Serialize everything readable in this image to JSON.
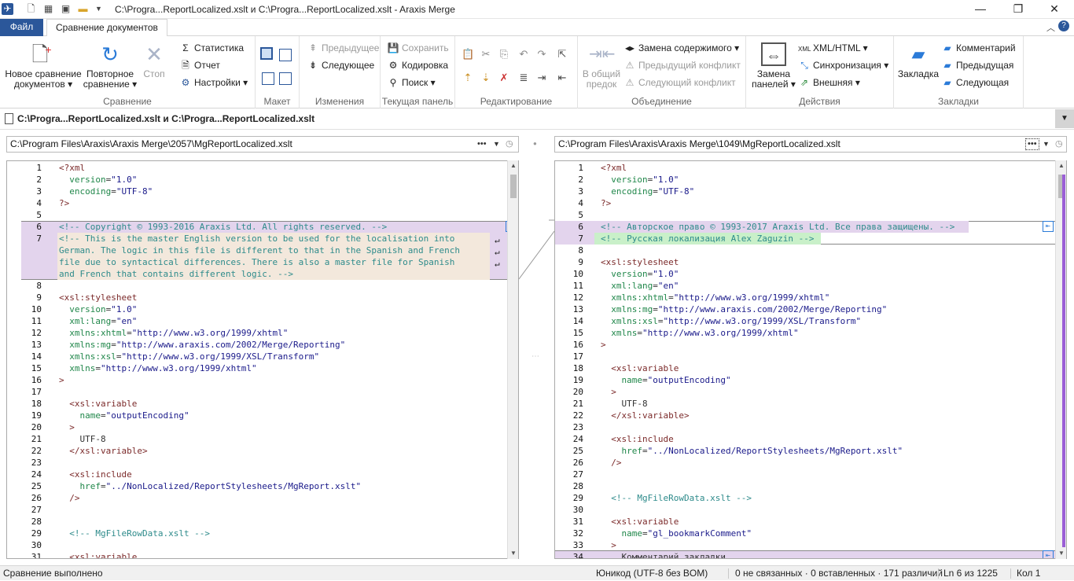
{
  "window": {
    "title": "C:\\Progra...ReportLocalized.xslt и C:\\Progra...ReportLocalized.xslt - Araxis Merge",
    "minimize": "—",
    "restore": "❐",
    "close": "✕"
  },
  "tabs": {
    "file": "Файл",
    "compare": "Сравнение документов"
  },
  "ribbon": {
    "compare_group": {
      "label": "Сравнение",
      "new_compare": "Новое сравнение документов",
      "new_compare_l1": "Новое сравнение",
      "new_compare_l2": "документов",
      "recompare_l1": "Повторное",
      "recompare_l2": "сравнение",
      "stop": "Стоп",
      "statistics": "Статистика",
      "report": "Отчет",
      "settings": "Настройки"
    },
    "layout_group": {
      "label": "Макет"
    },
    "changes_group": {
      "label": "Изменения",
      "previous": "Предыдущее",
      "next": "Следующее"
    },
    "panel_group": {
      "label": "Текущая панель",
      "save": "Сохранить",
      "encoding": "Кодировка",
      "search": "Поиск"
    },
    "edit_group": {
      "label": "Редактирование"
    },
    "merge_group": {
      "label": "Объединение",
      "common_ancestor_l1": "В общий",
      "common_ancestor_l2": "предок",
      "replace_content": "Замена содержимого",
      "prev_conflict": "Предыдущий конфликт",
      "next_conflict": "Следующий конфликт"
    },
    "actions_group": {
      "label": "Действия",
      "replace_panels_l1": "Замена",
      "replace_panels_l2": "панелей",
      "xml_html": "XML/HTML",
      "sync": "Синхронизация",
      "external": "Внешняя"
    },
    "bookmarks_group": {
      "label": "Закладки",
      "bookmark": "Закладка",
      "comment": "Комментарий",
      "previous": "Предыдущая",
      "next": "Следующая"
    }
  },
  "doc_tab": {
    "title": "C:\\Progra...ReportLocalized.xslt и C:\\Progra...ReportLocalized.xslt"
  },
  "left": {
    "path": "C:\\Program Files\\Araxis\\Araxis Merge\\2057\\MgReportLocalized.xslt",
    "lines": [
      {
        "n": "1",
        "t": "<?xml"
      },
      {
        "n": "2",
        "t": "  version=\"1.0\""
      },
      {
        "n": "3",
        "t": "  encoding=\"UTF-8\""
      },
      {
        "n": "4",
        "t": "?>"
      },
      {
        "n": "5",
        "t": ""
      },
      {
        "n": "6",
        "t": "<!-- Copyright © 1993-2016 Araxis Ltd. All rights reserved. -->"
      },
      {
        "n": "7",
        "t": "<!-- This is the master English version to be used for the localisation into"
      },
      {
        "n": "",
        "t": "German. The logic in this file is different to that in the Spanish and French"
      },
      {
        "n": "",
        "t": "file due to syntactical differences. There is also a master file for Spanish"
      },
      {
        "n": "",
        "t": "and French that contains different logic. -->"
      },
      {
        "n": "8",
        "t": ""
      },
      {
        "n": "9",
        "t": "<xsl:stylesheet"
      },
      {
        "n": "10",
        "t": "  version=\"1.0\""
      },
      {
        "n": "11",
        "t": "  xml:lang=\"en\""
      },
      {
        "n": "12",
        "t": "  xmlns:xhtml=\"http://www.w3.org/1999/xhtml\""
      },
      {
        "n": "13",
        "t": "  xmlns:mg=\"http://www.araxis.com/2002/Merge/Reporting\""
      },
      {
        "n": "14",
        "t": "  xmlns:xsl=\"http://www.w3.org/1999/XSL/Transform\""
      },
      {
        "n": "15",
        "t": "  xmlns=\"http://www.w3.org/1999/xhtml\""
      },
      {
        "n": "16",
        "t": ">"
      },
      {
        "n": "17",
        "t": ""
      },
      {
        "n": "18",
        "t": "  <xsl:variable"
      },
      {
        "n": "19",
        "t": "    name=\"outputEncoding\""
      },
      {
        "n": "20",
        "t": "  >"
      },
      {
        "n": "21",
        "t": "    UTF-8"
      },
      {
        "n": "22",
        "t": "  </xsl:variable>"
      },
      {
        "n": "23",
        "t": ""
      },
      {
        "n": "24",
        "t": "  <xsl:include"
      },
      {
        "n": "25",
        "t": "    href=\"../NonLocalized/ReportStylesheets/MgReport.xslt\""
      },
      {
        "n": "26",
        "t": "  />"
      },
      {
        "n": "27",
        "t": ""
      },
      {
        "n": "28",
        "t": ""
      },
      {
        "n": "29",
        "t": "  <!-- MgFileRowData.xslt -->"
      },
      {
        "n": "30",
        "t": ""
      },
      {
        "n": "31",
        "t": "  <xsl:variable"
      }
    ]
  },
  "right": {
    "path": "C:\\Program Files\\Araxis\\Araxis Merge\\1049\\MgReportLocalized.xslt",
    "lines": [
      {
        "n": "1",
        "t": "<?xml"
      },
      {
        "n": "2",
        "t": "  version=\"1.0\""
      },
      {
        "n": "3",
        "t": "  encoding=\"UTF-8\""
      },
      {
        "n": "4",
        "t": "?>"
      },
      {
        "n": "5",
        "t": ""
      },
      {
        "n": "6",
        "t": "<!-- Авторское право © 1993-2017 Araxis Ltd. Все права защищены. -->"
      },
      {
        "n": "7",
        "t": "<!-- Русская локализация Alex Zaguzin -->"
      },
      {
        "n": "8",
        "t": ""
      },
      {
        "n": "9",
        "t": "<xsl:stylesheet"
      },
      {
        "n": "10",
        "t": "  version=\"1.0\""
      },
      {
        "n": "11",
        "t": "  xml:lang=\"en\""
      },
      {
        "n": "12",
        "t": "  xmlns:xhtml=\"http://www.w3.org/1999/xhtml\""
      },
      {
        "n": "13",
        "t": "  xmlns:mg=\"http://www.araxis.com/2002/Merge/Reporting\""
      },
      {
        "n": "14",
        "t": "  xmlns:xsl=\"http://www.w3.org/1999/XSL/Transform\""
      },
      {
        "n": "15",
        "t": "  xmlns=\"http://www.w3.org/1999/xhtml\""
      },
      {
        "n": "16",
        "t": ">"
      },
      {
        "n": "17",
        "t": ""
      },
      {
        "n": "18",
        "t": "  <xsl:variable"
      },
      {
        "n": "19",
        "t": "    name=\"outputEncoding\""
      },
      {
        "n": "20",
        "t": "  >"
      },
      {
        "n": "21",
        "t": "    UTF-8"
      },
      {
        "n": "22",
        "t": "  </xsl:variable>"
      },
      {
        "n": "23",
        "t": ""
      },
      {
        "n": "24",
        "t": "  <xsl:include"
      },
      {
        "n": "25",
        "t": "    href=\"../NonLocalized/ReportStylesheets/MgReport.xslt\""
      },
      {
        "n": "26",
        "t": "  />"
      },
      {
        "n": "27",
        "t": ""
      },
      {
        "n": "28",
        "t": ""
      },
      {
        "n": "29",
        "t": "  <!-- MgFileRowData.xslt -->"
      },
      {
        "n": "30",
        "t": ""
      },
      {
        "n": "31",
        "t": "  <xsl:variable"
      },
      {
        "n": "32",
        "t": "    name=\"gl_bookmarkComment\""
      },
      {
        "n": "33",
        "t": "  >"
      },
      {
        "n": "34",
        "t": "    Комментарий закладки"
      }
    ]
  },
  "status": {
    "message": "Сравнение выполнено",
    "encoding": "Юникод (UTF-8 без BOM)",
    "diffs": "0 не связанных · 0 вставленных · 171 различий",
    "line": "Ln 6 из 1225",
    "col": "Кол 1"
  },
  "colors": {
    "accent": "#2b579a",
    "change_marker": "#9b5fd6",
    "changed_line": "#e3d4ed",
    "inserted_line": "#c9f0c9"
  }
}
